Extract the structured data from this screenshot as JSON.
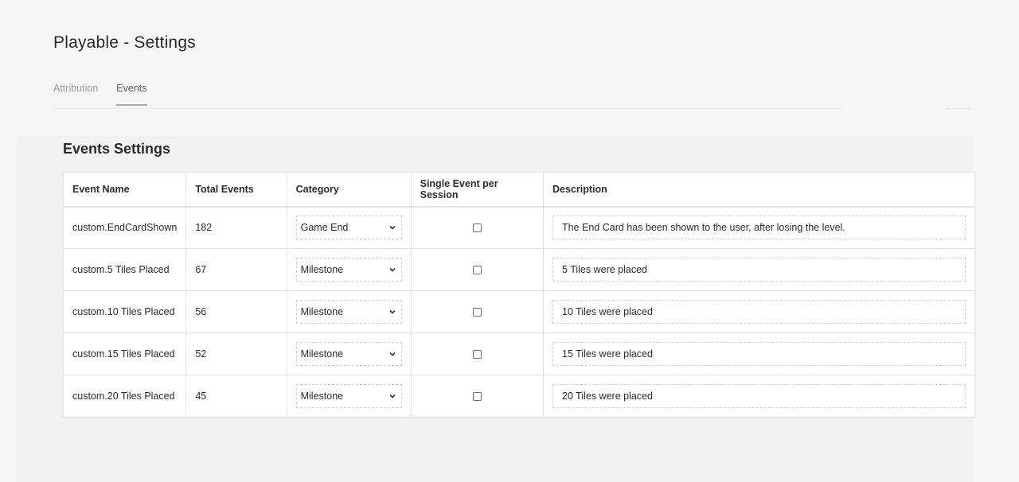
{
  "page": {
    "title": "Playable - Settings"
  },
  "tabs": [
    {
      "label": "Attribution",
      "active": false
    },
    {
      "label": "Events",
      "active": true
    }
  ],
  "panel": {
    "title": "Events Settings"
  },
  "table": {
    "headers": [
      "Event Name",
      "Total Events",
      "Category",
      "Single Event per Session",
      "Description"
    ],
    "rows": [
      {
        "event_name": "custom.EndCardShown",
        "total": "182",
        "category": "Game End",
        "single": false,
        "description": "The End Card has been shown to the user, after losing the level."
      },
      {
        "event_name": "custom.5 Tiles Placed",
        "total": "67",
        "category": "Milestone",
        "single": false,
        "description": "5 Tiles were placed"
      },
      {
        "event_name": "custom.10 Tiles Placed",
        "total": "56",
        "category": "Milestone",
        "single": false,
        "description": "10 Tiles were placed"
      },
      {
        "event_name": "custom.15 Tiles Placed",
        "total": "52",
        "category": "Milestone",
        "single": false,
        "description": "15 Tiles were placed"
      },
      {
        "event_name": "custom.20 Tiles Placed",
        "total": "45",
        "category": "Milestone",
        "single": false,
        "description": "20 Tiles were placed"
      }
    ]
  },
  "icons": {
    "select_chevron": "chevron-down-icon",
    "checkbox": "checkbox-icon"
  },
  "colors": {
    "tab_active_underline": "#b39ddb",
    "background": "#f5f6f5"
  }
}
